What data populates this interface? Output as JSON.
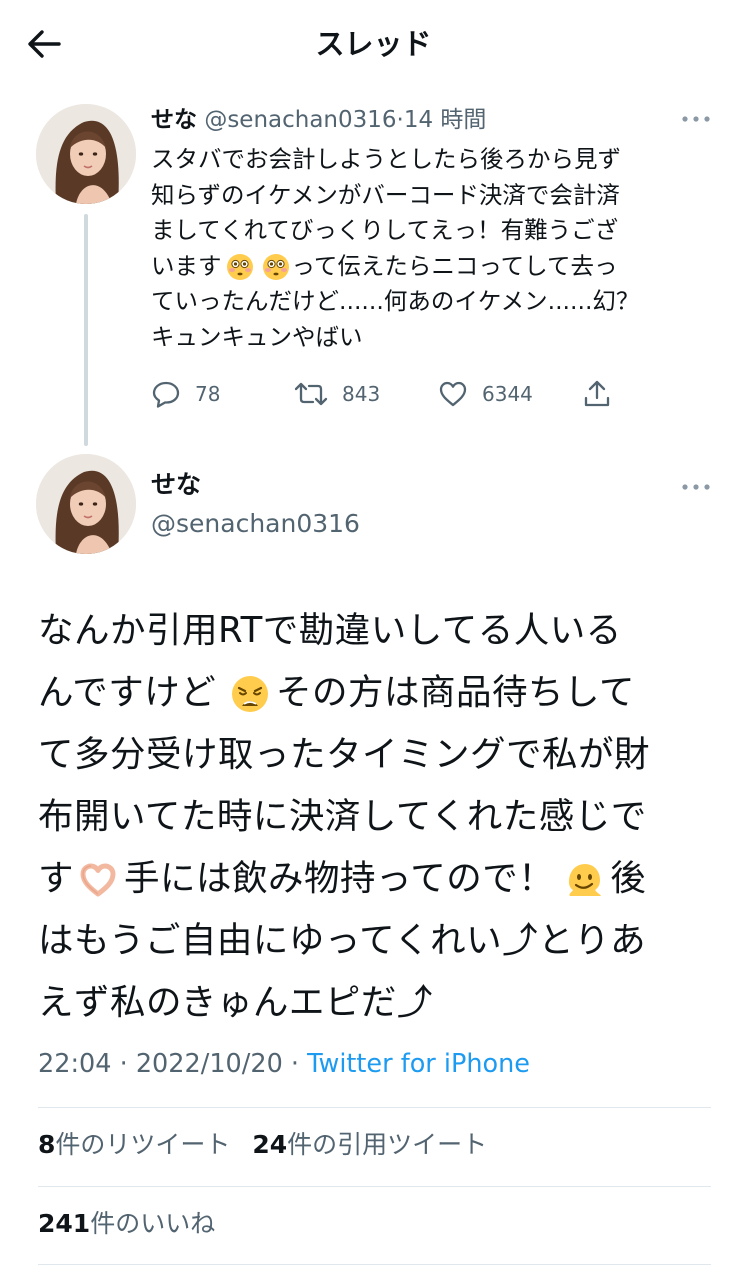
{
  "header": {
    "title": "スレッド"
  },
  "tweet1": {
    "name": "せな",
    "handle": "@senachan0316",
    "separator": "·",
    "time": "14 時間",
    "lines": [
      "スタバでお会計しようとしたら後ろから見ず",
      "知らずのイケメンがバーコード決済で会計済",
      "ましてくれてびっくりしてえっ！有難うござ",
      "います",
      "って伝えたらニコってして去っ",
      "ていったんだけど......何あのイケメン......幻？",
      "キュンキュンやばい"
    ],
    "emoji": "flushed-face-emoji",
    "replies": "78",
    "retweets": "843",
    "likes": "6344"
  },
  "tweet2": {
    "name": "せな",
    "handle": "@senachan0316",
    "line1": "なんか引用RTで勘違いしてる人いる",
    "line2a": "んですけど ",
    "line2b": "その方は商品待ちして",
    "line3": "て多分受け取ったタイミングで私が財",
    "line4": "布開いてた時に決済してくれた感じで",
    "line5a": "す",
    "line5b": "手には飲み物持ってので！",
    "line5c": "後",
    "line6": "はもうご自由にゆってくれい⤴︎とりあ",
    "line7": "えず私のきゅんエピだ⤴︎",
    "time": "22:04",
    "date": "2022/10/20",
    "dot": "·",
    "via": "Twitter for iPhone",
    "retweet_count": "8",
    "retweet_label": "件のリツイート",
    "quote_count": "24",
    "quote_label": "件の引用ツイート",
    "like_count": "241",
    "like_label": "件のいいね"
  },
  "colors": {
    "text": "#0f1419",
    "secondary": "#536471",
    "link": "#1d9bf0",
    "thread_line": "#cfd9de",
    "divider": "#e1e8ed"
  }
}
